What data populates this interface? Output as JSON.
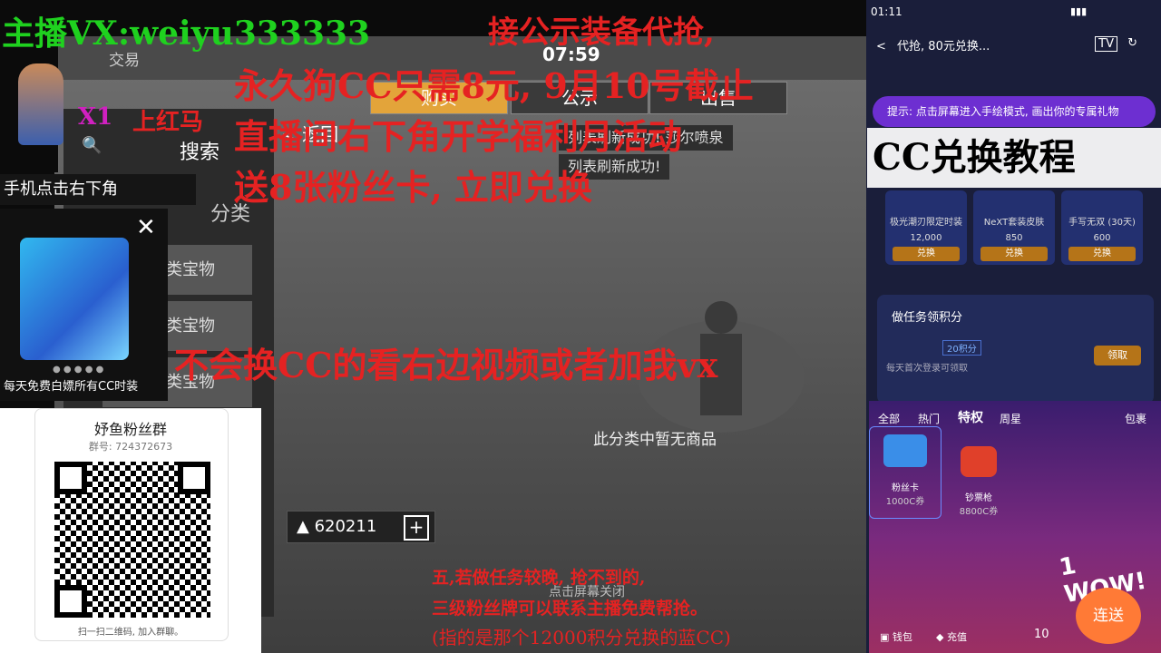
{
  "overlay": {
    "streamer_line": "主播VX:weiyu333333",
    "top_right_text": "接公示装备代抢,",
    "line1": "永久狗CC只需8元, 9月10号截止",
    "line2": "直播间右下角开学福利月活动",
    "line3": "送8张粉丝卡, 立即兑换",
    "middle_line": "不会换CC的看右边视频或者加我vx",
    "x1": "X1",
    "hongma": "上红马",
    "bottom1": "五,若做任务较晚, 抢不到的,",
    "bottom2": "三级粉丝牌可以联系主播免费帮抢。",
    "bottom3": "(指的是那个12000积分兑换的蓝CC)"
  },
  "left": {
    "phone_hint": "手机点击右下角",
    "ad_caption": "每天免费白嫖所有CC时装",
    "qr_title": "妤鱼粉丝群",
    "qr_group": "群号: 724372673",
    "qr_hint": "扫一扫二维码, 加入群聊。"
  },
  "game": {
    "timer": "07:59",
    "trade": "交易",
    "tabs": [
      "购买",
      "公示",
      "出售"
    ],
    "back": "返回",
    "search": "搜索",
    "category": "分类",
    "side_items": [
      "类宝物",
      "类宝物",
      "类宝物"
    ],
    "toast1": "列表刷新成功!",
    "toast2": "列表刷新成功!",
    "toast_bg": "莎尔喷泉",
    "empty": "此分类中暂无商品",
    "bottom_hint": "点击屏幕关闭",
    "coins": "620211",
    "plus": "+"
  },
  "phone": {
    "time": "01:11",
    "header_title": "代抢, 80元兑换...",
    "tip": "提示: 点击屏幕进入手绘模式, 画出你的专属礼物",
    "cc_title": "CC兑换教程",
    "cards": [
      {
        "name": "极光潮刃限定时装",
        "price": "12,000",
        "btn": "兑换"
      },
      {
        "name": "NeXT套装皮肤",
        "price": "850",
        "btn": "兑换"
      },
      {
        "name": "手写无双 (30天)",
        "price": "600",
        "btn": "兑换"
      }
    ],
    "task_title": "做任务领积分",
    "task_item": "每天首次登录可领取",
    "task_badge": "20积分",
    "task_btn": "领取",
    "gift_tabs": [
      "全部",
      "热门",
      "特权",
      "周星"
    ],
    "gift_pack": "包裹",
    "gifts": [
      {
        "name": "粉丝卡",
        "price": "1000C券"
      },
      {
        "name": "钞票枪",
        "price": "8800C券"
      }
    ],
    "wow": "1 WOW!",
    "send": "连送",
    "count": "10",
    "wallet": "钱包",
    "recharge": "充值"
  }
}
